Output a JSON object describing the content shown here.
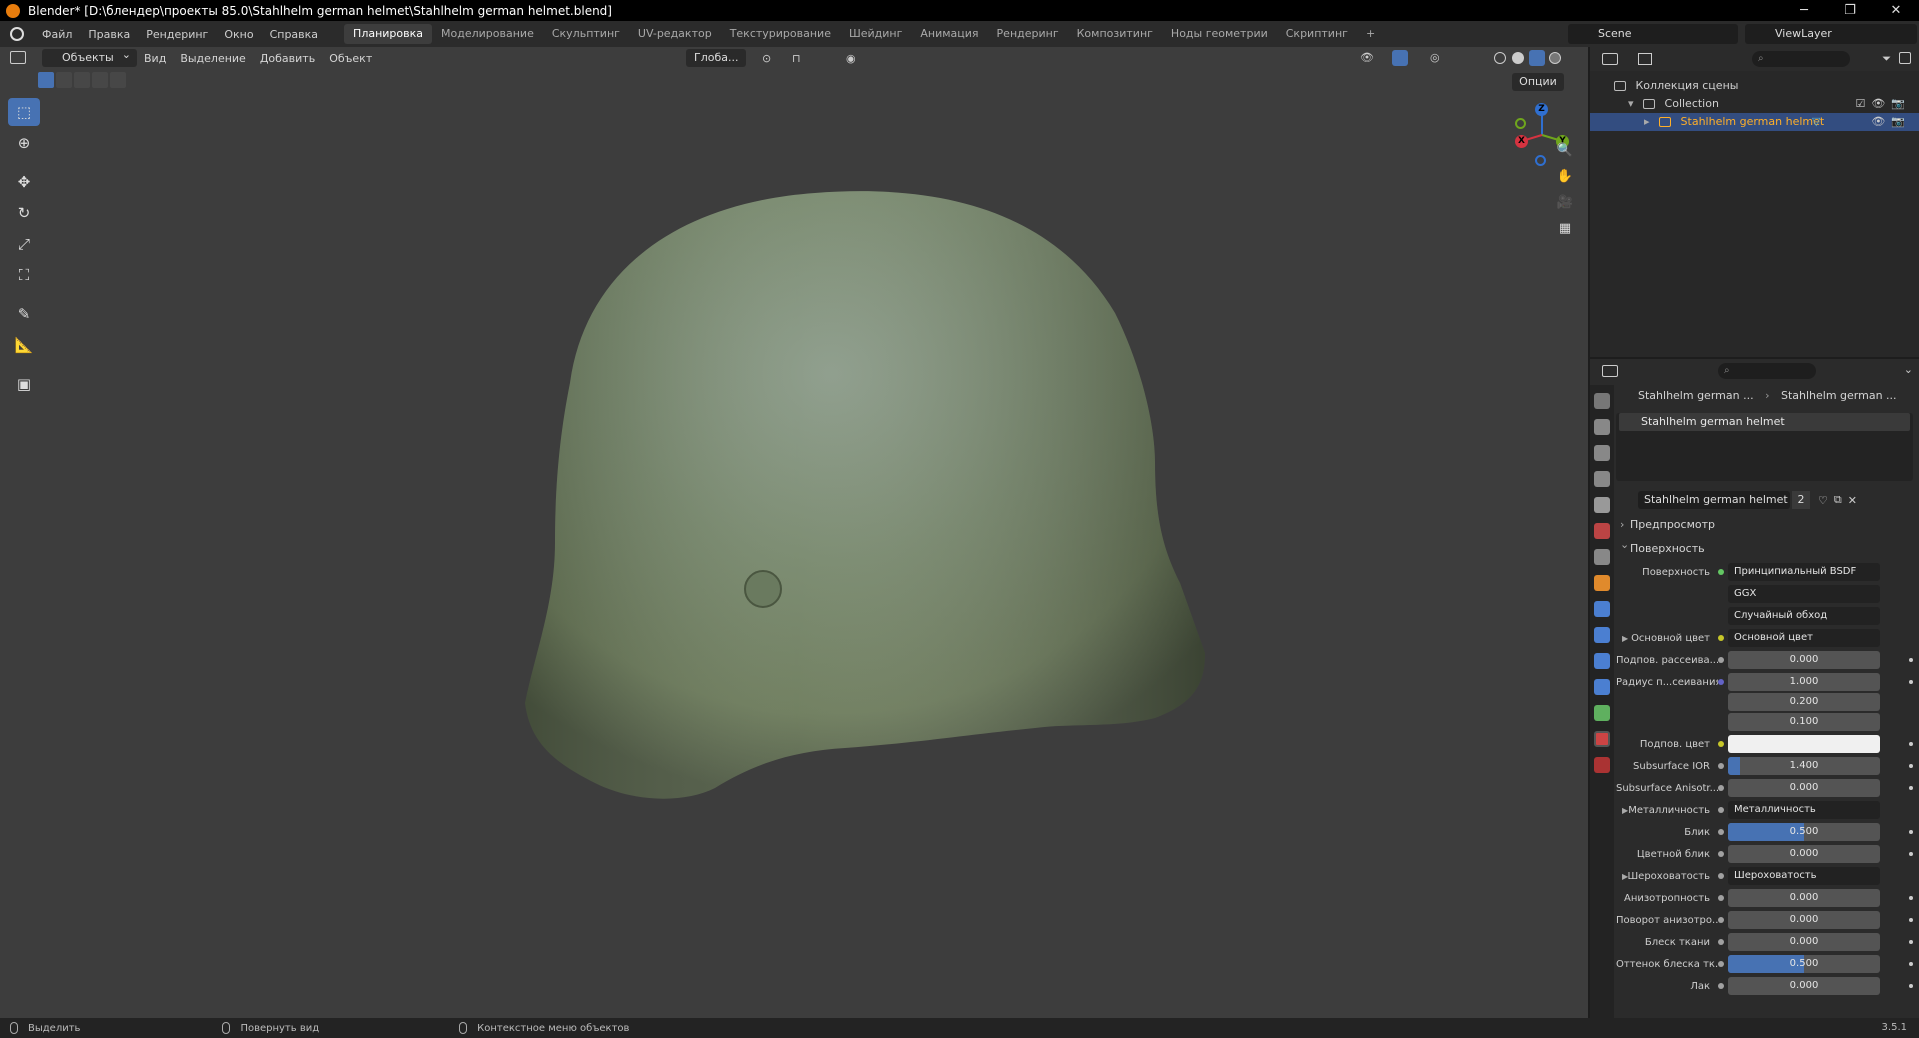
{
  "titlebar": {
    "title": "Blender* [D:\\блендер\\проекты 85.0\\Stahlhelm german helmet\\Stahlhelm german helmet.blend]",
    "min": "─",
    "max": "❐",
    "close": "✕"
  },
  "menu": {
    "file": "Файл",
    "edit": "Правка",
    "render": "Рендеринг",
    "window": "Окно",
    "help": "Справка"
  },
  "workspaces": [
    {
      "label": "Планировка",
      "active": true
    },
    {
      "label": "Моделирование"
    },
    {
      "label": "Скульптинг"
    },
    {
      "label": "UV-редактор"
    },
    {
      "label": "Текстурирование"
    },
    {
      "label": "Шейдинг"
    },
    {
      "label": "Анимация"
    },
    {
      "label": "Рендеринг"
    },
    {
      "label": "Композитинг"
    },
    {
      "label": "Ноды геометрии"
    },
    {
      "label": "Скриптинг"
    }
  ],
  "add_workspace": "+",
  "scene": "Scene",
  "view_layer": "ViewLayer",
  "viewport": {
    "mode": "Объекты",
    "view": "Вид",
    "select": "Выделение",
    "add": "Добавить",
    "object": "Объект",
    "orientation": "Глоба...",
    "options": "Опции"
  },
  "gizmo": {
    "x": "X",
    "y": "Y",
    "z": "Z"
  },
  "outliner": {
    "scene_collection": "Коллекция сцены",
    "collection": "Collection",
    "object": "Stahlhelm german helmet",
    "search_icon": "⌕"
  },
  "properties": {
    "crumb_object": "Stahlhelm german ...",
    "crumb_material": "Stahlhelm german ...",
    "slot": "Stahlhelm german helmet",
    "material": "Stahlhelm german helmet",
    "user_count": "2",
    "preview": "Предпросмотр",
    "surface_panel": "Поверхность",
    "rows": {
      "surface": {
        "label": "Поверхность",
        "value": "Принципиальный BSDF"
      },
      "distribution": {
        "value": "GGX"
      },
      "subsurface_method": {
        "value": "Случайный обход"
      },
      "base_color": {
        "label": "Основной цвет",
        "value": "Основной цвет"
      },
      "subsurface": {
        "label": "Подпов. рассеива...",
        "value": "0.000"
      },
      "subsurface_radius": {
        "label": "Радиус п...сеивания",
        "v1": "1.000",
        "v2": "0.200",
        "v3": "0.100"
      },
      "subsurface_color": {
        "label": "Подпов. цвет"
      },
      "subsurface_ior": {
        "label": "Subsurface IOR",
        "value": "1.400",
        "fill": 0.08
      },
      "subsurface_aniso": {
        "label": "Subsurface Anisotr...",
        "value": "0.000"
      },
      "metallic": {
        "label": "Металличность",
        "value": "Металличность"
      },
      "specular": {
        "label": "Блик",
        "value": "0.500",
        "fill": 0.5
      },
      "specular_tint": {
        "label": "Цветной блик",
        "value": "0.000"
      },
      "roughness": {
        "label": "Шероховатость",
        "value": "Шероховатость"
      },
      "anisotropic": {
        "label": "Анизотропность",
        "value": "0.000"
      },
      "aniso_rotation": {
        "label": "Поворот анизотро...",
        "value": "0.000"
      },
      "sheen": {
        "label": "Блеск ткани",
        "value": "0.000"
      },
      "sheen_tint": {
        "label": "Оттенок блеска тк...",
        "value": "0.500",
        "fill": 0.5
      },
      "clearcoat": {
        "label": "Лак",
        "value": "0.000"
      }
    }
  },
  "status": {
    "select": "Выделить",
    "rotate": "Повернуть вид",
    "context": "Контекстное меню объектов",
    "version": "3.5.1"
  },
  "colors": {
    "accent": "#4772b3",
    "selected_text": "#ffaf29",
    "helmet": "#7c8b6d"
  }
}
